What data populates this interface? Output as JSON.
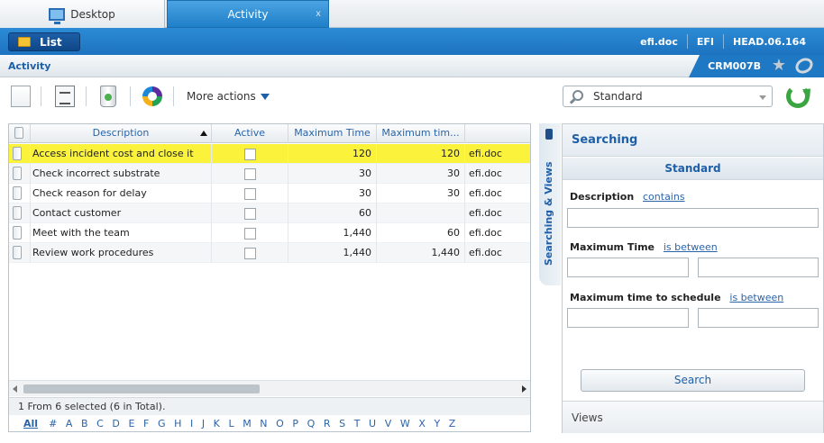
{
  "tabs": [
    {
      "label": "Desktop",
      "icon": "desktop-icon"
    },
    {
      "label": "Activity",
      "close": "x"
    }
  ],
  "header": {
    "list_label": "List",
    "info": [
      "efi.doc",
      "EFI",
      "HEAD.06.164"
    ]
  },
  "breadcrumb": {
    "title": "Activity",
    "code": "CRM007B"
  },
  "toolbar": {
    "more_actions": "More actions"
  },
  "grid": {
    "columns": [
      "Description",
      "Active",
      "Maximum Time",
      "Maximum tim...",
      ""
    ],
    "rows": [
      {
        "description": "Access incident cost and close it",
        "active": false,
        "max_time": "120",
        "max_time_schedule": "120",
        "source": "efi.doc",
        "selected": true
      },
      {
        "description": "Check incorrect substrate",
        "active": false,
        "max_time": "30",
        "max_time_schedule": "30",
        "source": "efi.doc",
        "selected": false
      },
      {
        "description": "Check reason for delay",
        "active": false,
        "max_time": "30",
        "max_time_schedule": "30",
        "source": "efi.doc",
        "selected": false
      },
      {
        "description": "Contact customer",
        "active": false,
        "max_time": "60",
        "max_time_schedule": "",
        "source": "efi.doc",
        "selected": false
      },
      {
        "description": "Meet with the team",
        "active": false,
        "max_time": "1,440",
        "max_time_schedule": "60",
        "source": "efi.doc",
        "selected": false
      },
      {
        "description": "Review work procedures",
        "active": false,
        "max_time": "1,440",
        "max_time_schedule": "1,440",
        "source": "efi.doc",
        "selected": false
      }
    ],
    "status": "1 From 6 selected (6 in Total).",
    "alpha_all": "All",
    "alpha": [
      "#",
      "A",
      "B",
      "C",
      "D",
      "E",
      "F",
      "G",
      "H",
      "I",
      "J",
      "K",
      "L",
      "M",
      "N",
      "O",
      "P",
      "Q",
      "R",
      "S",
      "T",
      "U",
      "V",
      "W",
      "X",
      "Y",
      "Z"
    ]
  },
  "side": {
    "view_selected": "Standard",
    "strip_label": "Searching & Views",
    "panel_title": "Searching",
    "panel_sub": "Standard",
    "fields": [
      {
        "label": "Description",
        "op": "contains"
      },
      {
        "label": "Maximum Time",
        "op": "is between"
      },
      {
        "label": "Maximum time to schedule",
        "op": "is between"
      }
    ],
    "search_button": "Search",
    "views_label": "Views"
  }
}
